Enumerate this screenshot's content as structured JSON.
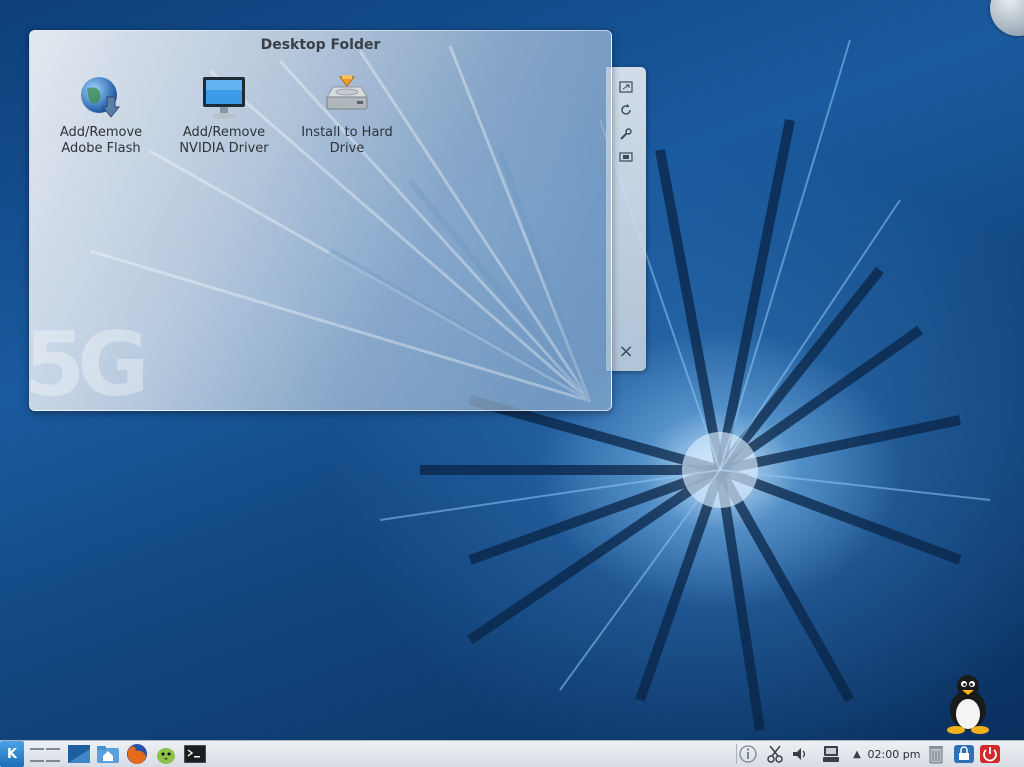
{
  "folder": {
    "title": "Desktop Folder",
    "watermark": "5G",
    "items": [
      {
        "label": "Add/Remove Adobe Flash",
        "icon": "globe-download-icon"
      },
      {
        "label": "Add/Remove NVIDIA Driver",
        "icon": "monitor-icon"
      },
      {
        "label": "Install to Hard Drive",
        "icon": "hard-drive-install-icon"
      }
    ]
  },
  "handle": {
    "buttons": [
      "resize-icon",
      "rotate-icon",
      "settings-wrench-icon",
      "fit-icon"
    ],
    "close": "×"
  },
  "taskbar": {
    "kmenu_label": "K",
    "clock": "02:00 pm",
    "launchers": [
      "desktop-icon",
      "home-folder-icon",
      "firefox-icon",
      "pidgin-icon",
      "terminal-icon"
    ],
    "tray": [
      "info-icon",
      "klipper-scissors-icon",
      "volume-icon",
      "network-icon",
      "expand-arrow-icon",
      "trash-icon",
      "lock-icon",
      "power-icon"
    ]
  },
  "colors": {
    "accent": "#1d6fb8",
    "wallpaper": "#12467f"
  }
}
